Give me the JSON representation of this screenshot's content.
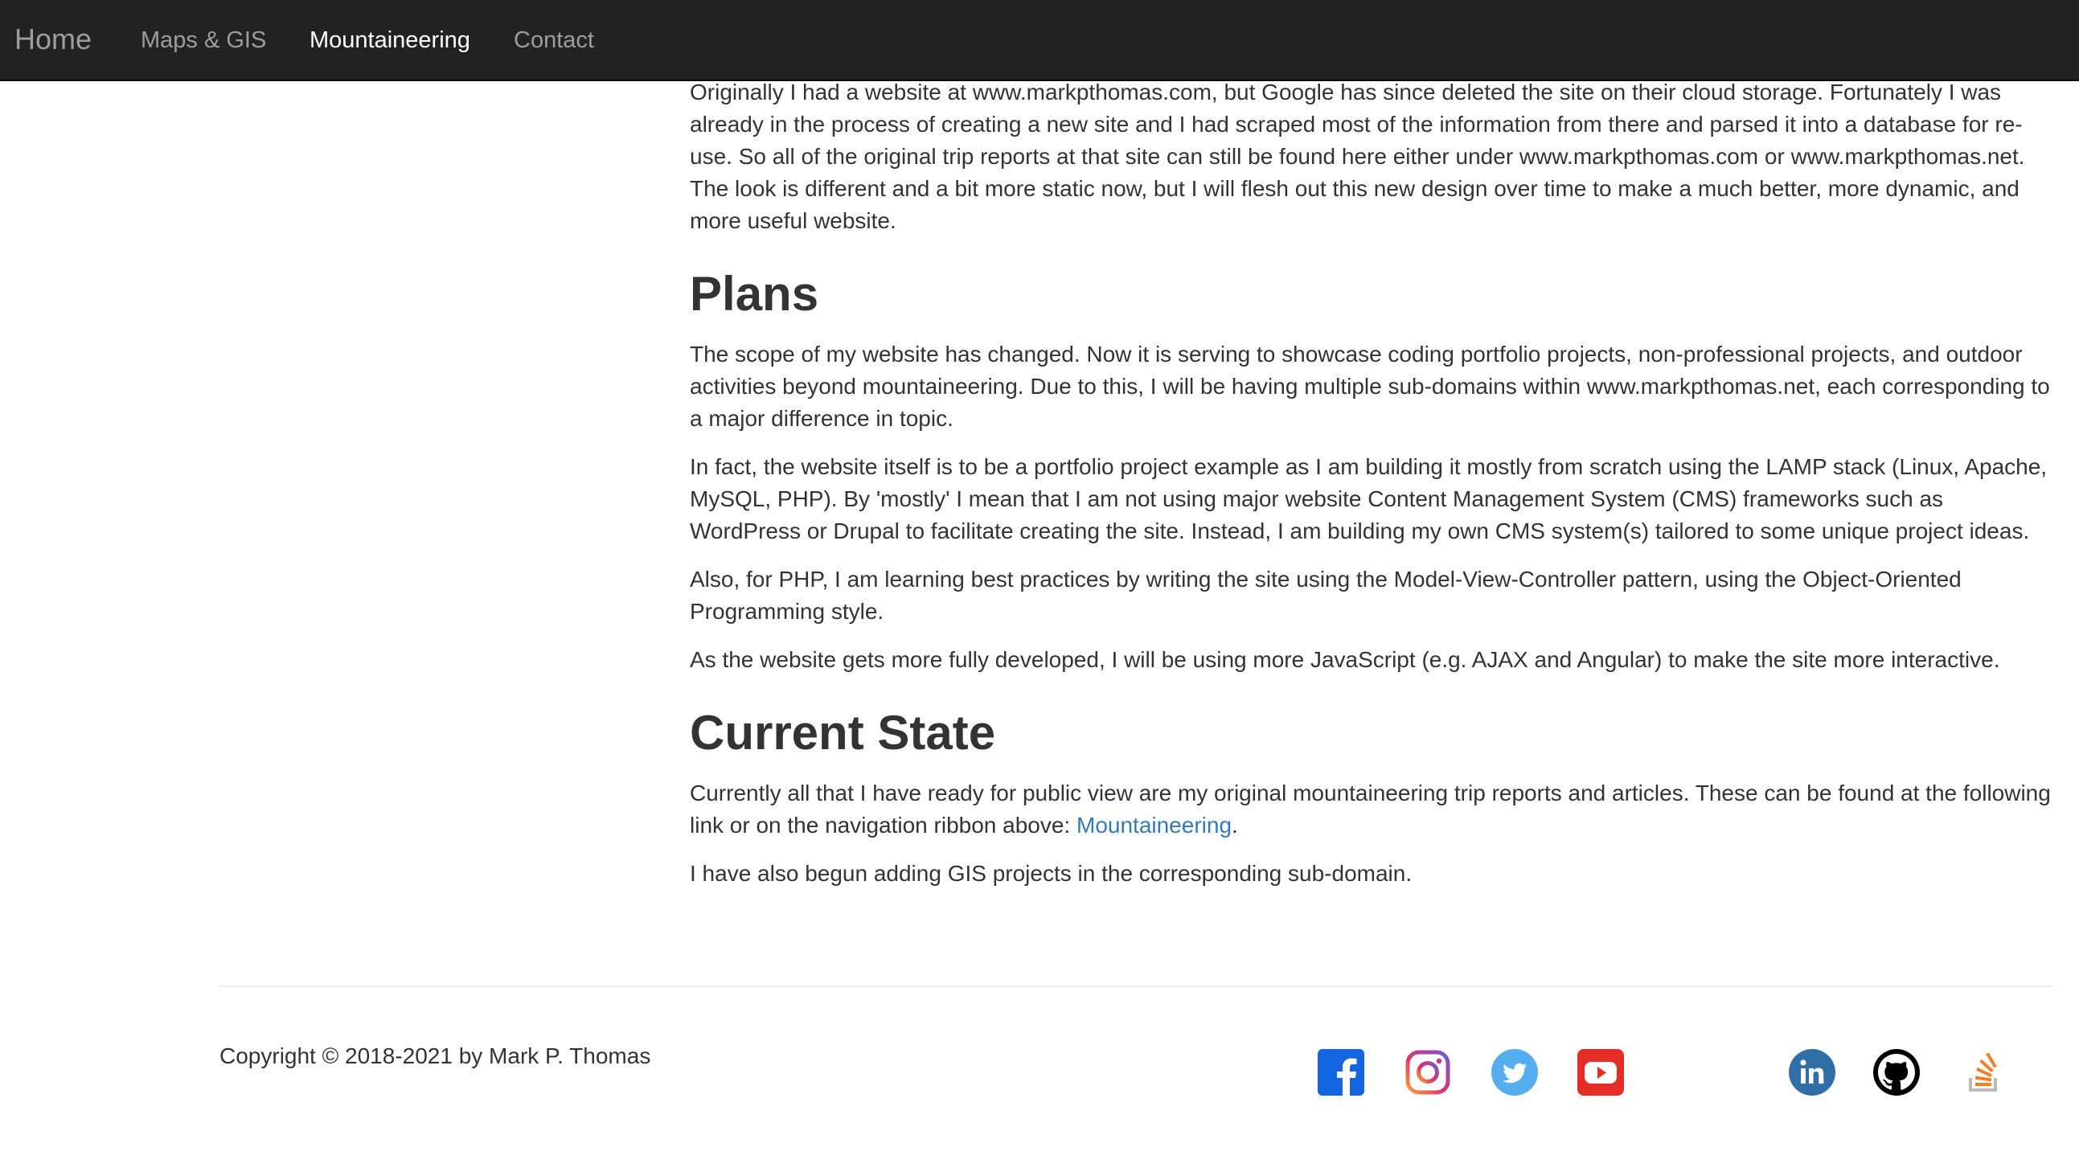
{
  "nav": {
    "brand": "Home",
    "items": [
      {
        "label": "Maps & GIS",
        "active": false
      },
      {
        "label": "Mountaineering",
        "active": true
      },
      {
        "label": "Contact",
        "active": false
      }
    ]
  },
  "intro": {
    "paragraph": "Originally I had a website at www.markpthomas.com, but Google has since deleted the site on their cloud storage. Fortunately I was already in the process of creating a new site and I had scraped most of the information from there and parsed it into a database for re-use. So all of the original trip reports at that site can still be found here either under www.markpthomas.com or www.markpthomas.net. The look is different and a bit more static now, but I will flesh out this new design over time to make a much better, more dynamic, and more useful website."
  },
  "plans": {
    "heading": "Plans",
    "paragraphs": [
      "The scope of my website has changed. Now it is serving to showcase coding portfolio projects, non-professional projects, and outdoor activities beyond mountaineering. Due to this, I will be having multiple sub-domains within www.markpthomas.net, each corresponding to a major difference in topic.",
      "In fact, the website itself is to be a portfolio project example as I am building it mostly from scratch using the LAMP stack (Linux, Apache, MySQL, PHP). By 'mostly' I mean that I am not using major website Content Management System (CMS) frameworks such as WordPress or Drupal to facilitate creating the site. Instead, I am building my own CMS system(s) tailored to some unique project ideas.",
      "Also, for PHP, I am learning best practices by writing the site using the Model-View-Controller pattern, using the Object-Oriented Programming style.",
      "As the website gets more fully developed, I will be using more JavaScript (e.g. AJAX and Angular) to make the site more interactive."
    ]
  },
  "current_state": {
    "heading": "Current State",
    "paragraph1_text": "Currently all that I have ready for public view are my original mountaineering trip reports and articles. These can be found at the following link or on the navigation ribbon above: ",
    "paragraph1_link": "Mountaineering",
    "paragraph1_end": ".",
    "paragraph2": "I have also begun adding GIS projects in the corresponding sub-domain."
  },
  "footer": {
    "copyright": "Copyright © 2018-2021 by Mark P. Thomas",
    "social": [
      {
        "icon": "facebook-icon",
        "color": "#3b5998"
      },
      {
        "icon": "instagram-icon",
        "color": "#c13584"
      },
      {
        "icon": "twitter-icon",
        "color": "#55acee"
      },
      {
        "icon": "youtube-icon",
        "color": "#e52d27"
      },
      {
        "icon": "linkedin-icon",
        "color": "#2f6fa6"
      },
      {
        "icon": "github-icon",
        "color": "#000000"
      },
      {
        "icon": "stackoverflow-icon",
        "color": "#f48024"
      }
    ]
  }
}
